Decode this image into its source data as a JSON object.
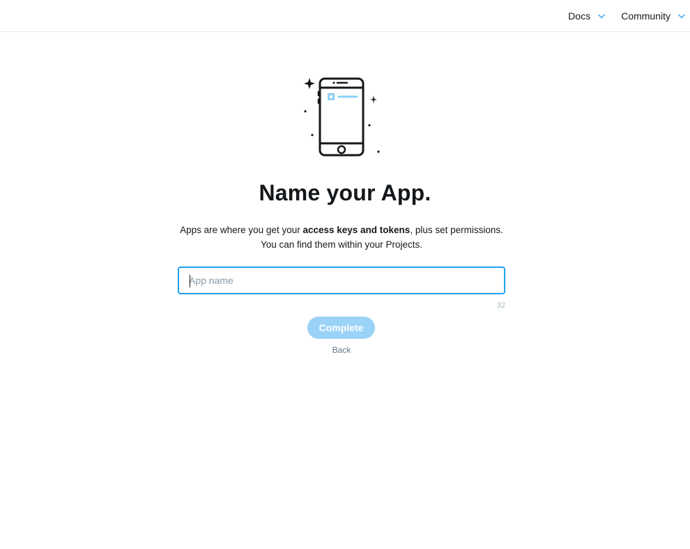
{
  "nav": {
    "items": [
      {
        "label": "Docs",
        "icon": "chevron-down-icon"
      },
      {
        "label": "Community",
        "icon": "chevron-down-icon"
      }
    ]
  },
  "hero": {
    "icon": "smartphone-sparkle-icon",
    "title": "Name your App.",
    "desc_part1": "Apps are where you get your ",
    "desc_bold": "access keys and tokens",
    "desc_part2": ", plus set permissions.",
    "desc_line2": "You can find them within your Projects."
  },
  "form": {
    "app_name": {
      "value": "",
      "placeholder": "App name",
      "remaining_chars": "32"
    },
    "complete_label": "Complete",
    "back_label": "Back"
  },
  "colors": {
    "accent": "#1da1f2",
    "button_disabled": "#9ad3f7",
    "text_primary": "#14171a",
    "text_muted": "#657786"
  }
}
